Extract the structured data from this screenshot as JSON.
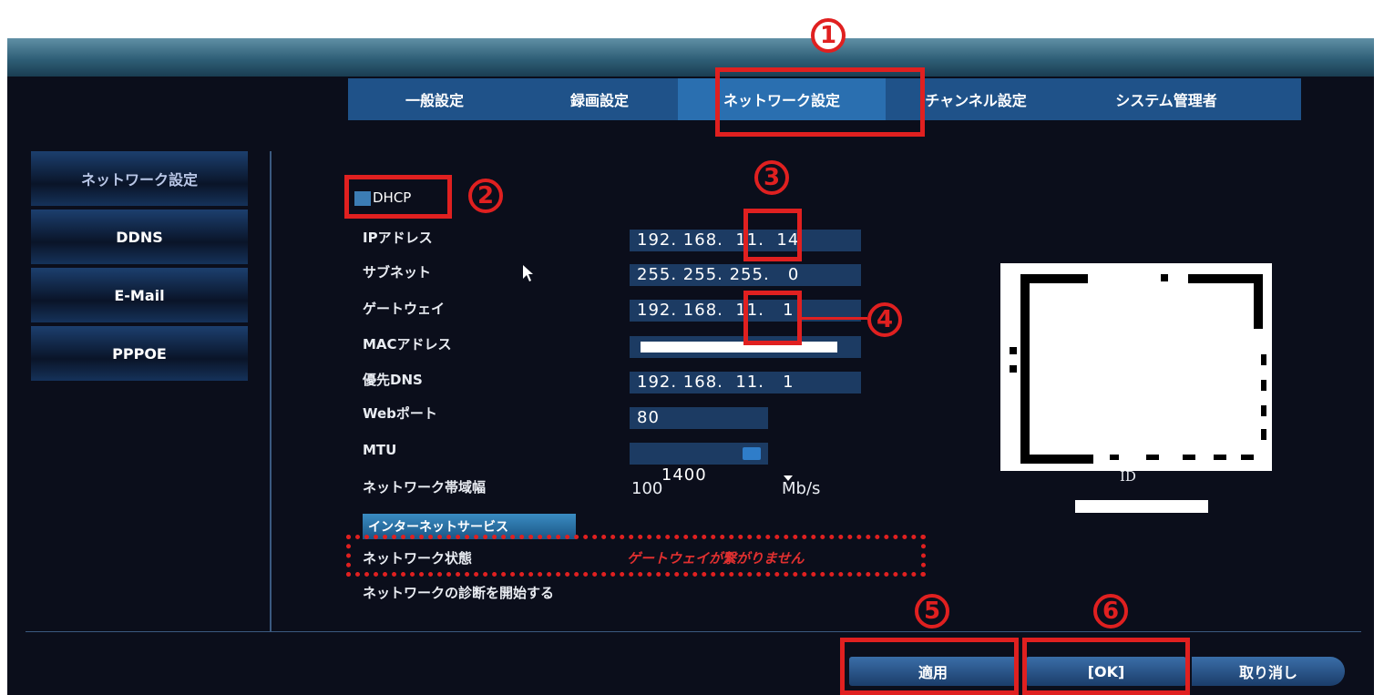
{
  "tabs": [
    {
      "label": "一般設定"
    },
    {
      "label": "録画設定"
    },
    {
      "label": "ネットワーク設定"
    },
    {
      "label": "チャンネル設定"
    },
    {
      "label": "システム管理者"
    }
  ],
  "sidebar": {
    "items": [
      {
        "label": "ネットワーク設定"
      },
      {
        "label": "DDNS"
      },
      {
        "label": "E-Mail"
      },
      {
        "label": "PPPOE"
      }
    ]
  },
  "dhcp": {
    "label": "DHCP",
    "checked": true
  },
  "form": {
    "ip_label": "IPアドレス",
    "ip_value": "192. 168.  11.  14",
    "subnet_label": "サブネット",
    "subnet_value": "255. 255. 255.   0",
    "gateway_label": "ゲートウェイ",
    "gateway_value": "192. 168.  11.   1",
    "mac_label": "MACアドレス",
    "dns_label": "優先DNS",
    "dns_value": "192. 168.  11.   1",
    "web_label": "Webポート",
    "web_value": "80",
    "mtu_label": "MTU",
    "mtu_value": "1400",
    "bandwidth_label": "ネットワーク帯域幅",
    "bandwidth_value": "100",
    "bandwidth_unit": "Mb/s",
    "internet_button": "インターネットサービス",
    "status_label": "ネットワーク状態",
    "status_value": "ゲートウェイが繋がりません",
    "diagnose_label": "ネットワークの診断を開始する"
  },
  "qr": {
    "id_label": "ID"
  },
  "buttons": {
    "apply": "適用",
    "ok": "[OK]",
    "cancel": "取り消し"
  },
  "callouts": [
    "1",
    "2",
    "3",
    "4",
    "5",
    "6"
  ],
  "colors": {
    "accent_red": "#e02020",
    "tab_bar": "#1f5289",
    "status_text": "#e03030"
  }
}
